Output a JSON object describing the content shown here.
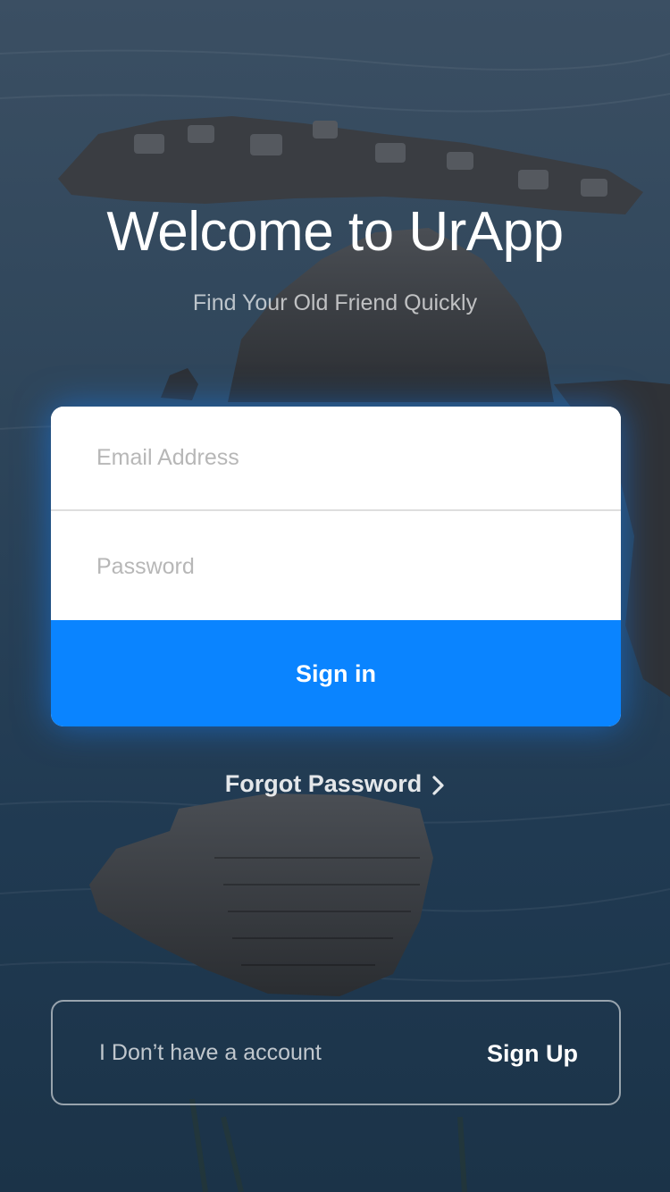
{
  "header": {
    "title": "Welcome to UrApp",
    "subtitle": "Find Your Old Friend Quickly"
  },
  "form": {
    "email_placeholder": "Email Address",
    "password_placeholder": "Password",
    "signin_label": "Sign in"
  },
  "forgot": {
    "label": "Forgot Password",
    "icon": "chevron-right-icon"
  },
  "account": {
    "prompt": "I Don’t have a account",
    "signup_label": "Sign Up"
  },
  "colors": {
    "accent": "#0a84ff",
    "background": "#24384a"
  }
}
